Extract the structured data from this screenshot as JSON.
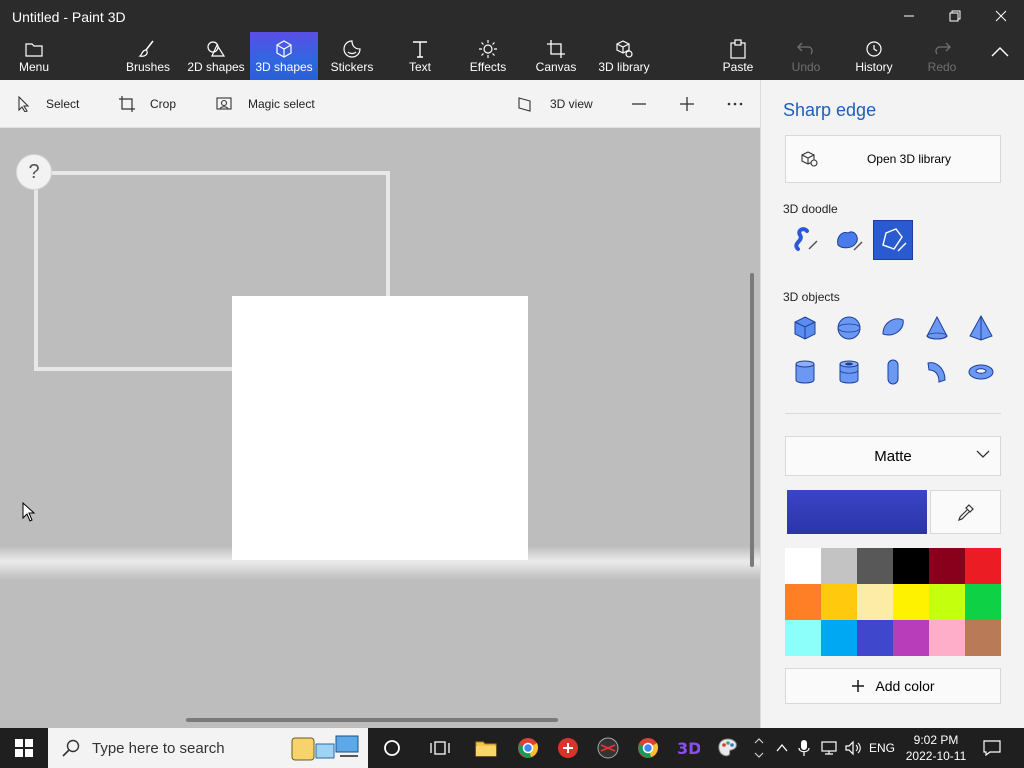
{
  "window": {
    "title": "Untitled - Paint 3D"
  },
  "ribbon": {
    "menu": "Menu",
    "tabs": [
      {
        "label": "Brushes"
      },
      {
        "label": "2D shapes"
      },
      {
        "label": "3D shapes",
        "active": true
      },
      {
        "label": "Stickers"
      },
      {
        "label": "Text"
      },
      {
        "label": "Effects"
      },
      {
        "label": "Canvas"
      },
      {
        "label": "3D library"
      }
    ],
    "paste": "Paste",
    "undo": "Undo",
    "history": "History",
    "redo": "Redo"
  },
  "toolbar": {
    "select": "Select",
    "crop": "Crop",
    "magic_select": "Magic select",
    "view_3d": "3D view"
  },
  "canvas": {
    "help": "?"
  },
  "panel": {
    "title": "Sharp edge",
    "open_library": "Open 3D library",
    "doodle_heading": "3D doodle",
    "objects_heading": "3D objects",
    "material": "Matte",
    "current_color": "#3a45c8",
    "palette": [
      "#ffffff",
      "#c3c3c3",
      "#585858",
      "#000000",
      "#88001b",
      "#ec1c24",
      "#ff7f27",
      "#ffc90e",
      "#fdeca6",
      "#fff200",
      "#c4ff0e",
      "#0ed145",
      "#8cfffb",
      "#00a8f3",
      "#3f48cc",
      "#b83dba",
      "#ffaec9",
      "#b97a57"
    ],
    "add_color": "Add color"
  },
  "taskbar": {
    "search_placeholder": "Type here to search",
    "language": "ENG",
    "time": "9:02 PM",
    "date": "2022-10-11"
  }
}
